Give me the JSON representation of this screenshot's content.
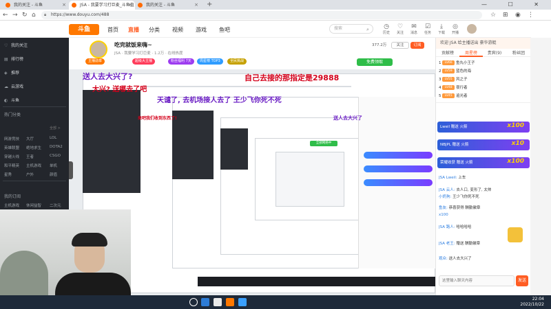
{
  "browser": {
    "tabs": [
      {
        "title": "我的关注 - 斗鱼",
        "active": false
      },
      {
        "title": "JSA - 我要学习打巨麦_斗鱼直",
        "active": true
      },
      {
        "title": "我的关注 - 斗鱼",
        "active": false
      }
    ],
    "new_tab": "+",
    "window_controls": "— ☐ ✕",
    "url": "https://www.douyu.com/488"
  },
  "site": {
    "logo": "斗鱼",
    "nav": [
      "首页",
      "直播",
      "分类",
      "视频",
      "游戏",
      "鱼吧"
    ],
    "active_nav": "直播",
    "search_placeholder": "搜索",
    "header_icons": [
      {
        "icon": "history-icon",
        "label": "历史"
      },
      {
        "icon": "follow-icon",
        "label": "关注"
      },
      {
        "icon": "message-icon",
        "label": "消息"
      },
      {
        "icon": "task-icon",
        "label": "任务"
      },
      {
        "icon": "download-icon",
        "label": "下载"
      },
      {
        "icon": "live-icon",
        "label": "开播"
      }
    ]
  },
  "sidebar": {
    "items": [
      "我的关注",
      "排行榜",
      "推荐",
      "云游戏"
    ],
    "hot_label": "斗鱼",
    "section1": "热门分类",
    "section1_more": "全部 >",
    "grid1": [
      [
        "网游竞技",
        "大厅",
        "LOL"
      ],
      [
        "英雄联盟",
        "绝地求生",
        "DOTA2"
      ],
      [
        "穿越火线",
        "王者",
        "CSGO"
      ],
      [
        "和平精英",
        "主机游戏",
        "单机"
      ],
      [
        "星秀",
        "户外",
        "颜值"
      ]
    ],
    "section2": "我的订阅",
    "grid2": [
      "主机游戏",
      "休闲益智",
      "二次元"
    ]
  },
  "room": {
    "title": "吃完就饭来嗨~",
    "meta": "JSA · 我要学习打巨麦 · 1.2万 · 在线热度",
    "badges": [
      {
        "text": "主播勋章",
        "color": "#ff7800"
      },
      {
        "text": "超级大主播",
        "color": "#ff3c5a"
      },
      {
        "text": "粉丝福利 7天",
        "color": "#9d3cf0"
      },
      {
        "text": "周星榜 TOP3",
        "color": "#2f9cff"
      },
      {
        "text": "全民挑战",
        "color": "#c6a100"
      }
    ],
    "follow_label": "关注",
    "follow_count": "377.2万",
    "sub_label": "订阅",
    "gift_label": "免费领取"
  },
  "video": {
    "overlay_texts": [
      "送人去大兴了?",
      "大兴? 送哪去了吧",
      "自己去接的那指定是29888",
      "天谴了, 去机场接人去了 王少飞你死不死",
      "全部网络中",
      "来吧我们收到东西了!",
      "送人去大兴了"
    ]
  },
  "right_panel": {
    "top_notice": "欢迎 JSA 给主播送出 豪华游艇",
    "tabs": [
      "贡献榜",
      "周星榜",
      "贵宾(9)",
      "粉丝团"
    ],
    "active_tab": "周星榜",
    "ranks": [
      {
        "rank": "1",
        "level": "LV66",
        "name": "鱼丸小王子"
      },
      {
        "rank": "2",
        "level": "LV59",
        "name": "蓝色的海"
      },
      {
        "rank": "3",
        "level": "LV55",
        "name": "风之子"
      },
      {
        "rank": "4",
        "level": "LV48",
        "name": "夜行者"
      },
      {
        "rank": "5",
        "level": "LV45",
        "name": "追光者"
      }
    ],
    "gift_banners": [
      {
        "user": "Lweil",
        "msg": "赠送 火箭",
        "mult": "x100"
      },
      {
        "user": "NBJPL",
        "msg": "赠送 火箭",
        "mult": "x10"
      },
      {
        "user": "荣耀收获",
        "msg": "赠送 火箭",
        "mult": "x100"
      }
    ],
    "chat": [
      {
        "who": "JSA Lweil:",
        "text": "上车"
      },
      {
        "who": "JSA 云人:",
        "text": "去人口, 变形了, 太帅"
      },
      {
        "who": "小奶狗:",
        "text": "王少飞你死不死"
      },
      {
        "who": "鱼友:",
        "text": "恭喜获得 酬勤徽章"
      },
      {
        "who": "x100",
        "text": ""
      },
      {
        "who": "JSA 路人:",
        "text": "哈哈哈哈"
      },
      {
        "who": "JSA 老王:",
        "text": "赠送 酬勤徽章"
      },
      {
        "who": "观众:",
        "text": "送人去大兴了"
      }
    ],
    "input_placeholder": "这里输入聊天内容",
    "send_label": "发送"
  },
  "taskbar": {
    "time": "22:04",
    "date": "2022/10/22"
  }
}
